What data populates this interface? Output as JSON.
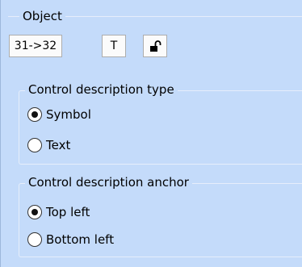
{
  "object_group": {
    "title": "Object",
    "buttons": {
      "course_label": "31->32",
      "text_label": "T",
      "lock_icon": "unlock-icon"
    }
  },
  "type_group": {
    "title": "Control description type",
    "options": [
      {
        "label": "Symbol",
        "checked": true
      },
      {
        "label": "Text",
        "checked": false
      }
    ]
  },
  "anchor_group": {
    "title": "Control description anchor",
    "options": [
      {
        "label": "Top left",
        "checked": true
      },
      {
        "label": "Bottom left",
        "checked": false
      }
    ]
  }
}
